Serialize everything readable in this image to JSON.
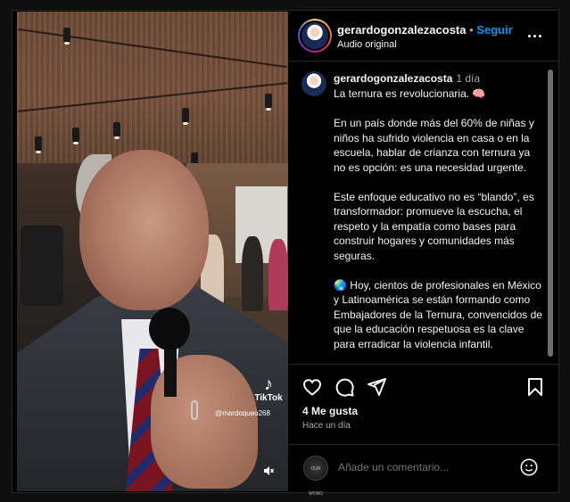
{
  "post": {
    "username": "gerardogonzalezacosta",
    "separator": "•",
    "follow_label": "Seguir",
    "audio_label": "Audio original"
  },
  "caption": {
    "username": "gerardogonzalezacosta",
    "time": "1 día",
    "text": "La ternura es revolucionaria. 🧠\n\nEn un país donde más del 60% de niñas y niños ha sufrido violencia en casa o en la escuela, hablar de crianza con ternura ya no es opción: es una necesidad urgente.\n\nEste enfoque educativo no es “blando”, es transformador: promueve la escucha, el respeto y la empatía como bases para construir hogares y comunidades más seguras.\n\n🌏 Hoy, cientos de profesionales en México y Latinoamérica se están formando como Embajadores de la Ternura, convencidos de que la educación respetuosa es la clave para erradicar la violencia infantil."
  },
  "video": {
    "watermark_brand": "TikTok",
    "watermark_handle": "@mardoqueo268"
  },
  "engagement": {
    "likes": "4 Me gusta",
    "posted": "Hace un día"
  },
  "comment": {
    "placeholder": "Añade un comentario...",
    "avatar_text": "OUR WORD"
  },
  "icons": {
    "like": "heart-icon",
    "comment": "comment-icon",
    "share": "share-icon",
    "save": "bookmark-icon",
    "more": "more-icon",
    "mute": "mute-icon",
    "emoji": "emoji-icon"
  },
  "colors": {
    "accent": "#0095f6",
    "background": "#000000",
    "text": "#f5f5f5",
    "muted": "#a8a8a8"
  }
}
